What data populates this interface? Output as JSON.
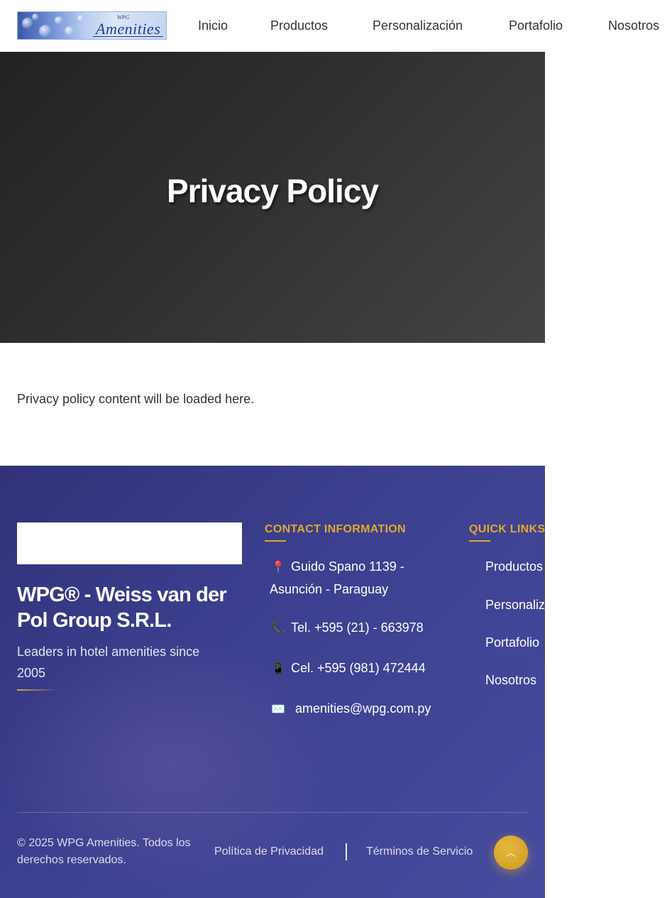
{
  "header": {
    "logo": {
      "small_text": "WPG",
      "text": "Amenities"
    },
    "nav": [
      {
        "label": "Inicio"
      },
      {
        "label": "Productos"
      },
      {
        "label": "Personalización"
      },
      {
        "label": "Portafolio"
      },
      {
        "label": "Nosotros"
      }
    ]
  },
  "hero": {
    "title": "Privacy Policy"
  },
  "content": {
    "text": "Privacy policy content will be loaded here."
  },
  "footer": {
    "company_name": "WPG® - Weiss van der Pol Group S.R.L.",
    "tagline": "Leaders in hotel amenities since 2005",
    "contact": {
      "heading": "CONTACT INFORMATION",
      "items": [
        {
          "icon": "map-pin-icon",
          "glyph": "📍",
          "text": "Guido Spano 1139 - Asunción - Paraguay"
        },
        {
          "icon": "phone-icon",
          "glyph": "📞",
          "text": "Tel. +595 (21) - 663978"
        },
        {
          "icon": "mobile-icon",
          "glyph": "📱",
          "text": "Cel. +595 (981) 472444"
        },
        {
          "icon": "envelope-icon",
          "glyph": "✉️",
          "text": "amenities@wpg.com.py"
        }
      ]
    },
    "quick_links": {
      "heading": "QUICK LINKS",
      "items": [
        {
          "label": "Productos"
        },
        {
          "label": "Personalización"
        },
        {
          "label": "Portafolio"
        },
        {
          "label": "Nosotros"
        }
      ]
    },
    "copyright": "© 2025 WPG Amenities. Todos los derechos reservados.",
    "legal": {
      "privacy": "Política de Privacidad",
      "terms": "Términos de Servicio"
    },
    "back_to_top": {
      "icon": "chevron-up-icon",
      "glyph": "︿"
    }
  },
  "colors": {
    "accent_gold": "#e0a82e",
    "footer_bg": "#3c3f8e",
    "hero_bg": "#303030",
    "logo_blue": "#1f3a98"
  }
}
